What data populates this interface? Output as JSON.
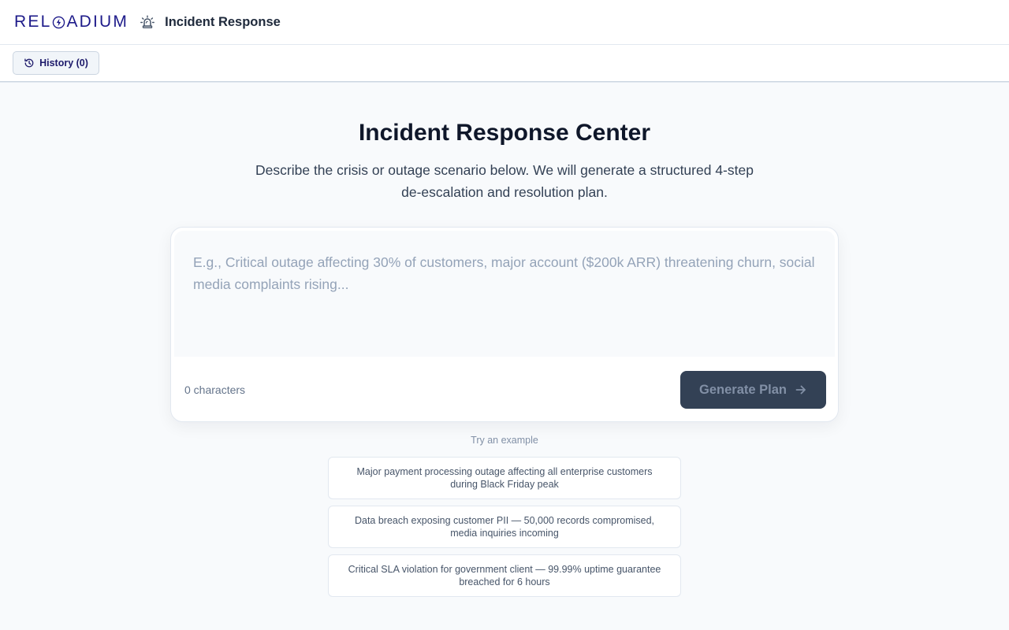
{
  "header": {
    "brand_left": "REL",
    "brand_right": "ADIUM",
    "app_title": "Incident Response"
  },
  "toolbar": {
    "history_label": "History (0)"
  },
  "main": {
    "title": "Incident Response Center",
    "subtitle": "Describe the crisis or outage scenario below. We will generate a structured 4-step de-escalation and resolution plan.",
    "input": {
      "value": "",
      "placeholder": "E.g., Critical outage affecting 30% of customers, major account ($200k ARR) threatening churn, social media complaints rising..."
    },
    "char_count": "0 characters",
    "generate_label": "Generate Plan"
  },
  "examples": {
    "label": "Try an example",
    "items": [
      "Major payment processing outage affecting all enterprise customers during Black Friday peak",
      "Data breach exposing customer PII — 50,000 records compromised, media inquiries incoming",
      "Critical SLA violation for government client — 99.99% uptime guarantee breached for 6 hours"
    ]
  },
  "colors": {
    "brand": "#1e1b8a",
    "primary_button": "#334155",
    "background": "#f8fafc"
  },
  "icons": {
    "brand_o": "bolt-circle-icon",
    "app": "siren-icon",
    "history": "history-icon",
    "generate": "arrow-right-icon"
  }
}
